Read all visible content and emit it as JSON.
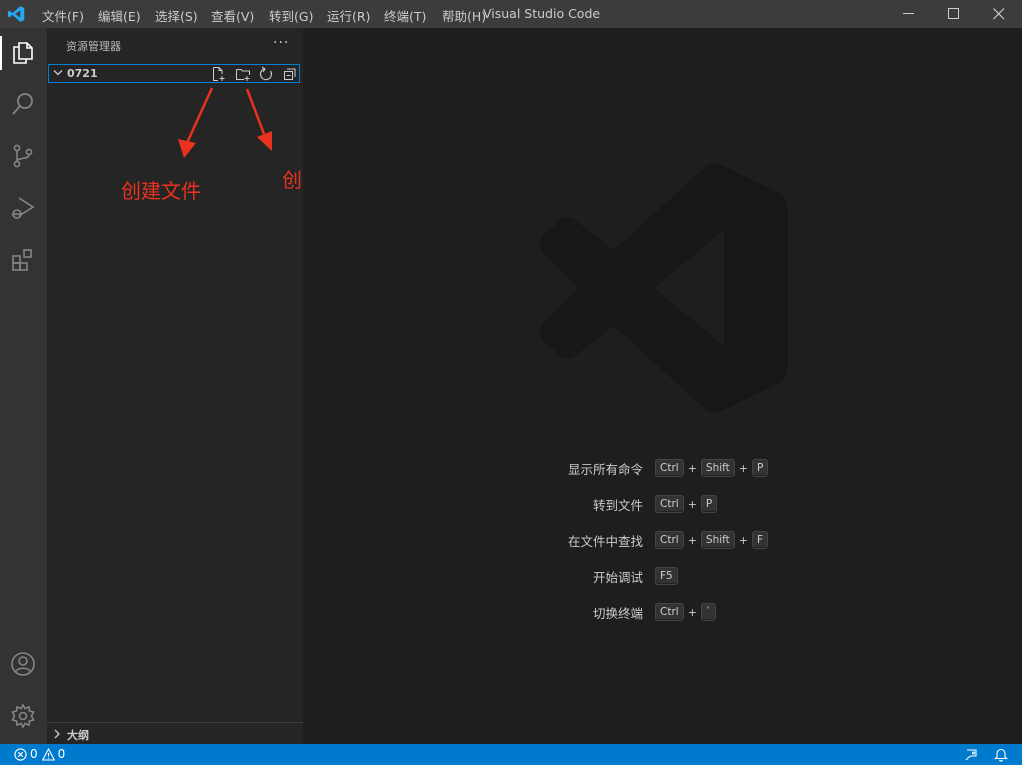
{
  "window": {
    "title": "Visual Studio Code"
  },
  "menu": [
    {
      "label": "文件(F)"
    },
    {
      "label": "编辑(E)"
    },
    {
      "label": "选择(S)"
    },
    {
      "label": "查看(V)"
    },
    {
      "label": "转到(G)"
    },
    {
      "label": "运行(R)"
    },
    {
      "label": "终端(T)"
    },
    {
      "label": "帮助(H)"
    }
  ],
  "activity_bar": {
    "items": [
      "files-icon",
      "search-icon",
      "source-control-icon",
      "run-debug-icon",
      "extensions-icon"
    ],
    "bottom_items": [
      "account-icon",
      "gear-icon"
    ]
  },
  "sidebar": {
    "title": "资源管理器",
    "more": "···",
    "folder": {
      "name": "0721",
      "actions": [
        "new-file-icon",
        "new-folder-icon",
        "refresh-icon",
        "collapse-all-icon"
      ]
    },
    "outline_label": "大纲"
  },
  "annotations": {
    "create_file": "创建文件",
    "create_folder": "创建文件夹",
    "color": "#e8321e"
  },
  "editor": {
    "shortcuts": [
      {
        "label": "显示所有命令",
        "keys": [
          "Ctrl",
          "Shift",
          "P"
        ]
      },
      {
        "label": "转到文件",
        "keys": [
          "Ctrl",
          "P"
        ]
      },
      {
        "label": "在文件中查找",
        "keys": [
          "Ctrl",
          "Shift",
          "F"
        ]
      },
      {
        "label": "开始调试",
        "keys": [
          "F5"
        ]
      },
      {
        "label": "切换终端",
        "keys": [
          "Ctrl",
          "`"
        ]
      }
    ],
    "plus": "+"
  },
  "statusbar": {
    "errors": "0",
    "warnings": "0",
    "color": "#007acc"
  }
}
